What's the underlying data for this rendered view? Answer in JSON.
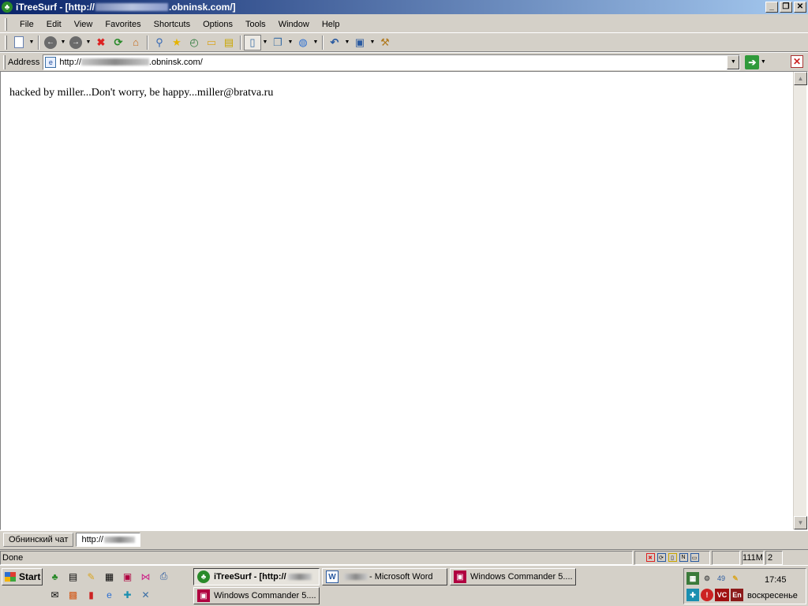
{
  "window": {
    "title_prefix": "iTreeSurf - [http://",
    "title_suffix": ".obninsk.com/]",
    "minimize": "_",
    "restore": "❐",
    "close": "✕"
  },
  "menu": [
    "File",
    "Edit",
    "View",
    "Favorites",
    "Shortcuts",
    "Options",
    "Tools",
    "Window",
    "Help"
  ],
  "address": {
    "label": "Address",
    "url_prefix": "http://",
    "url_suffix": ".obninsk.com/"
  },
  "page": {
    "text": "hacked by miller...Don't worry, be happy...miller@bratva.ru"
  },
  "tabs": [
    "Обнинский чат",
    "http://"
  ],
  "status": {
    "text": "Done",
    "memory": "111M",
    "count": "2"
  },
  "taskbar": {
    "start": "Start",
    "buttons": {
      "itreesurf": "iTreeSurf - [http://",
      "word": "- Microsoft Word",
      "wincmd1": "Windows Commander 5....",
      "wincmd2": "Windows Commander 5...."
    },
    "tray": {
      "num": "49",
      "vc": "VC",
      "lang": "En"
    },
    "clock": "17:45",
    "day": "воскресенье"
  }
}
